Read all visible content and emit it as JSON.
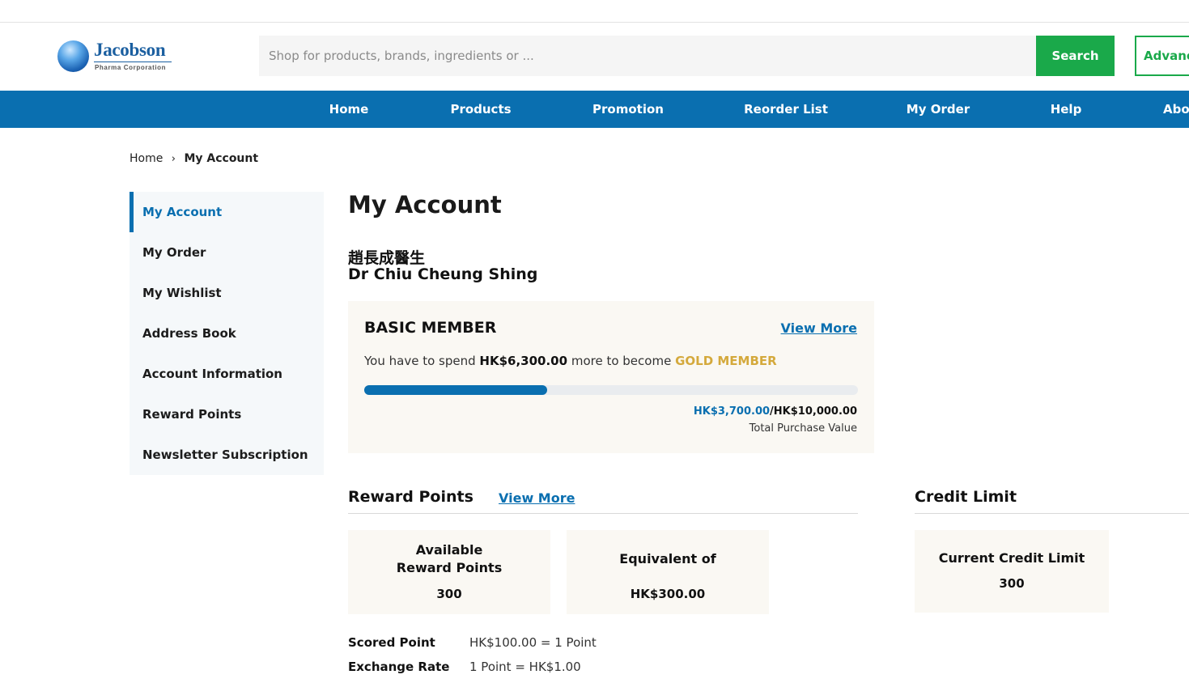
{
  "header": {
    "logo_name": "Jacobson",
    "logo_sub": "Pharma Corporation",
    "search_placeholder": "Shop for products, brands, ingredients or ...",
    "search_button": "Search",
    "advanced_button": "Advanced"
  },
  "nav": {
    "items": [
      "Home",
      "Products",
      "Promotion",
      "Reorder List",
      "My Order",
      "Help",
      "About"
    ]
  },
  "breadcrumb": {
    "home": "Home",
    "separator": "›",
    "current": "My Account"
  },
  "sidebar": {
    "items": [
      {
        "label": "My Account",
        "active": true
      },
      {
        "label": "My Order",
        "active": false
      },
      {
        "label": "My Wishlist",
        "active": false
      },
      {
        "label": "Address Book",
        "active": false
      },
      {
        "label": "Account Information",
        "active": false
      },
      {
        "label": "Reward Points",
        "active": false
      },
      {
        "label": "Newsletter Subscription",
        "active": false
      }
    ]
  },
  "account": {
    "title": "My Account",
    "name_zh": "趙長成醫生",
    "name_en": "Dr Chiu Cheung Shing"
  },
  "membership": {
    "tier": "BASIC MEMBER",
    "view_more": "View More",
    "spend_prefix": "You have to spend",
    "spend_amount": "HK$6,300.00",
    "spend_middle": "more to become",
    "next_tier": "GOLD MEMBER",
    "progress_fraction": 0.37,
    "current_value": "HK$3,700.00",
    "target_value": "/HK$10,000.00",
    "value_label": "Total Purchase Value"
  },
  "reward_points": {
    "title": "Reward Points",
    "view_more": "View More",
    "available_label_1": "Available",
    "available_label_2": "Reward Points",
    "available_value": "300",
    "equivalent_label": "Equivalent of",
    "equivalent_value": "HK$300.00",
    "scored_key": "Scored Point",
    "scored_val": "HK$100.00 = 1 Point",
    "exchange_key": "Exchange Rate",
    "exchange_val": "1 Point = HK$1.00"
  },
  "credit_limit": {
    "title": "Credit Limit",
    "current_label": "Current Credit Limit",
    "current_value": "300"
  },
  "colors": {
    "brand_blue": "#0a6fb0",
    "search_green": "#1aa94a",
    "gold": "#d4a93c",
    "card_bg": "#faf8f3"
  }
}
